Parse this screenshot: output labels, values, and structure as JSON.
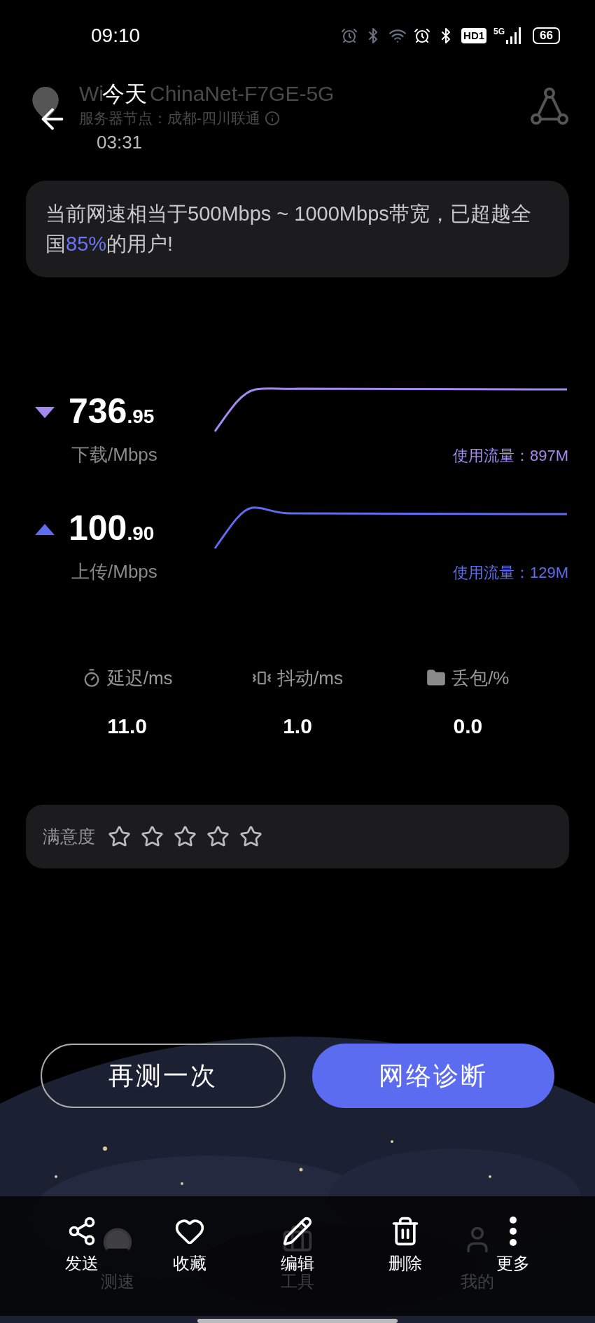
{
  "status_bar": {
    "time": "09:10",
    "hd": "HD1",
    "network": "5G",
    "battery": "66"
  },
  "app_header": {
    "title_start": "Wi",
    "title_end": "ChinaNet-F7GE-5G",
    "subtitle": "服务器节点：成都-四川联通"
  },
  "gallery_header": {
    "title": "今天",
    "time": "03:31"
  },
  "summary": {
    "before": "当前网速相当于500Mbps ~ 1000Mbps带宽，已超越全国",
    "highlight": "85%",
    "after": "的用户!"
  },
  "speeds": [
    {
      "kind": "download",
      "value": "736",
      "decimal": ".95",
      "unit": "下载/Mbps",
      "usage": "使用流量：897M",
      "color": "#a48af0"
    },
    {
      "kind": "upload",
      "value": "100",
      "decimal": ".90",
      "unit": "上传/Mbps",
      "usage": "使用流量：129M",
      "color": "#5f6cf0"
    }
  ],
  "metrics": [
    {
      "kind": "latency",
      "label": "延迟/ms",
      "value": "11.0"
    },
    {
      "kind": "jitter",
      "label": "抖动/ms",
      "value": "1.0"
    },
    {
      "kind": "packet_loss",
      "label": "丢包/%",
      "value": "0.0"
    }
  ],
  "rating": {
    "label": "满意度",
    "stars": 0
  },
  "buttons": [
    {
      "kind": "outline",
      "label": "再测一次"
    },
    {
      "kind": "primary",
      "label": "网络诊断"
    }
  ],
  "gallery_toolbar": [
    {
      "kind": "share",
      "label": "发送"
    },
    {
      "kind": "favorite",
      "label": "收藏"
    },
    {
      "kind": "edit",
      "label": "编辑"
    },
    {
      "kind": "delete",
      "label": "删除"
    },
    {
      "kind": "more",
      "label": "更多"
    }
  ],
  "app_tabs": [
    {
      "kind": "speed",
      "label": "测速",
      "selected": true
    },
    {
      "kind": "tools",
      "label": "工具",
      "selected": false
    },
    {
      "kind": "profile",
      "label": "我的",
      "selected": false
    }
  ]
}
